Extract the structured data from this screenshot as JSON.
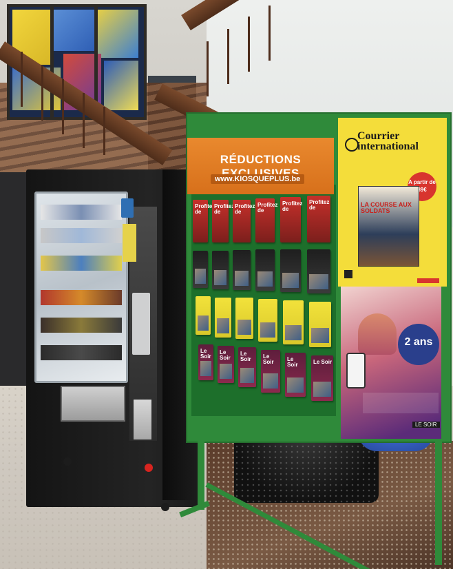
{
  "scene": {
    "description_type": "photo",
    "colors": {
      "stand_green": "#2f8a3a",
      "promo_orange": "#e9892e",
      "courrier_yellow": "#f4dd3a",
      "vending_black": "#1a1a1a"
    }
  },
  "promo_board": {
    "headline": "RÉDUCTIONS EXCLUSIVES",
    "url": "www.KIOSQUEPLUS.be"
  },
  "leaflets": {
    "red_rows_text": "Profitez de",
    "purple_row_text": "Le Soir"
  },
  "courrier_poster": {
    "brand": "Courrier international",
    "badge": "A partir de 89€",
    "magazine_title": "LA COURSE AUX SOLDATS"
  },
  "pink_poster": {
    "circle_text": "2 ans",
    "footer": "LE SOIR"
  }
}
